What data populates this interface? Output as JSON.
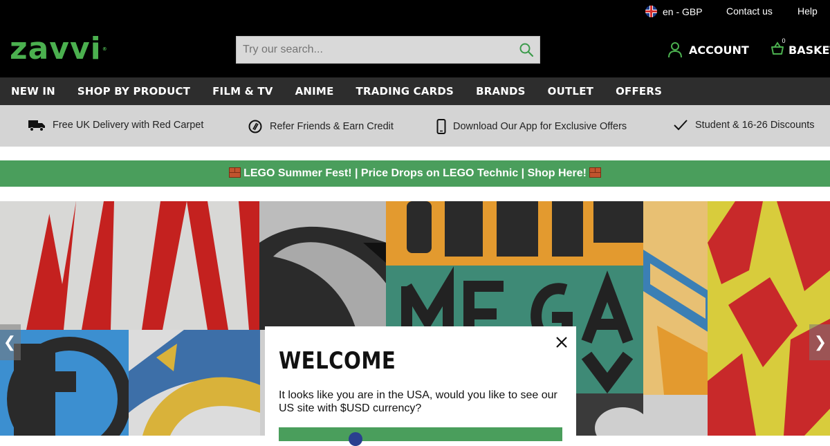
{
  "topbar": {
    "language": "en - GBP",
    "contact": "Contact us",
    "help": "Help"
  },
  "header": {
    "logo": "zavvi",
    "search_placeholder": "Try our search...",
    "account_label": "ACCOUNT",
    "basket_label": "BASKET",
    "basket_count": "0"
  },
  "nav": {
    "items": [
      "NEW IN",
      "SHOP BY PRODUCT",
      "FILM & TV",
      "ANIME",
      "TRADING CARDS",
      "BRANDS",
      "OUTLET",
      "OFFERS"
    ]
  },
  "usp": {
    "delivery": "Free UK Delivery with Red Carpet",
    "refer": "Refer Friends & Earn Credit",
    "app": "Download Our App for Exclusive Offers",
    "student": "Student & 16-26 Discounts"
  },
  "promo": {
    "text": "LEGO Summer Fest! | Price Drops on LEGO Technic | Shop Here!"
  },
  "hero": {
    "prev": "❮",
    "next": "❯"
  },
  "modal": {
    "title": "WELCOME",
    "message": "It looks like you are in the USA, would you like to see our US site with $USD currency?"
  },
  "colors": {
    "brand_green": "#4bb04f",
    "promo_green": "#4a9e5c",
    "nav_bg": "#2d2d2d",
    "usp_bg": "#d4d4d4"
  }
}
